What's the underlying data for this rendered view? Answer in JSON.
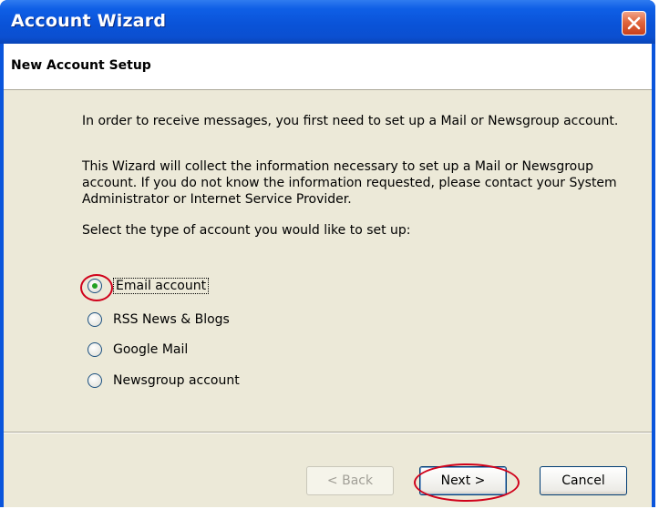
{
  "window": {
    "title": "Account Wizard"
  },
  "header": {
    "title": "New Account Setup"
  },
  "body": {
    "intro": "In order to receive messages, you first need to set up a Mail or Newsgroup account.",
    "info": "This Wizard will collect the information necessary to set up a Mail or Newsgroup account. If you do not know the information requested, please contact your System Administrator or Internet Service Provider.",
    "prompt": "Select the type of account you would like to set up:"
  },
  "account_types": [
    {
      "label": "Email account",
      "selected": true
    },
    {
      "label": "RSS News & Blogs",
      "selected": false
    },
    {
      "label": "Google Mail",
      "selected": false
    },
    {
      "label": "Newsgroup account",
      "selected": false
    }
  ],
  "buttons": {
    "back": "< Back",
    "next": "Next >",
    "cancel": "Cancel"
  },
  "colors": {
    "titlebar": "#0a53d8",
    "dialog_bg": "#ece9d8",
    "annotation_ring": "#d0021b",
    "selected_radio": "#21a121"
  }
}
